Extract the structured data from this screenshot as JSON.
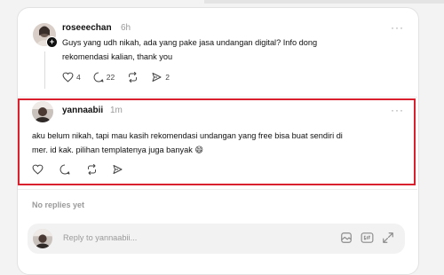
{
  "thread": {
    "parent_post": {
      "username": "roseeechan",
      "time": "6h",
      "more_label": "···",
      "text_line1": "Guys yang udh nikah, ada yang pake jasa undangan digital? Info dong",
      "text_line2": "rekomendasi kalian, thank you",
      "likes": "4",
      "comments": "22",
      "shares": "2"
    },
    "reply_post": {
      "username": "yannaabii",
      "time": "1m",
      "more_label": "···",
      "text_line1": "aku belum nikah, tapi mau kasih rekomendasi undangan yang free bisa buat sendiri di",
      "text_line2": "mer. id kak. pilihan templatenya juga banyak 😄"
    },
    "no_replies_label": "No replies yet",
    "reply_input": {
      "placeholder": "Reply to yannaabii..."
    }
  },
  "colors": {
    "highlight_border": "#d8202f",
    "muted_text": "#9a9a9a",
    "card_bg": "#ffffff",
    "input_bg": "#f2f2f2"
  },
  "icons": [
    "heart-icon",
    "comment-icon",
    "repost-icon",
    "share-icon",
    "image-icon",
    "gif-icon",
    "expand-icon",
    "plus-icon"
  ]
}
